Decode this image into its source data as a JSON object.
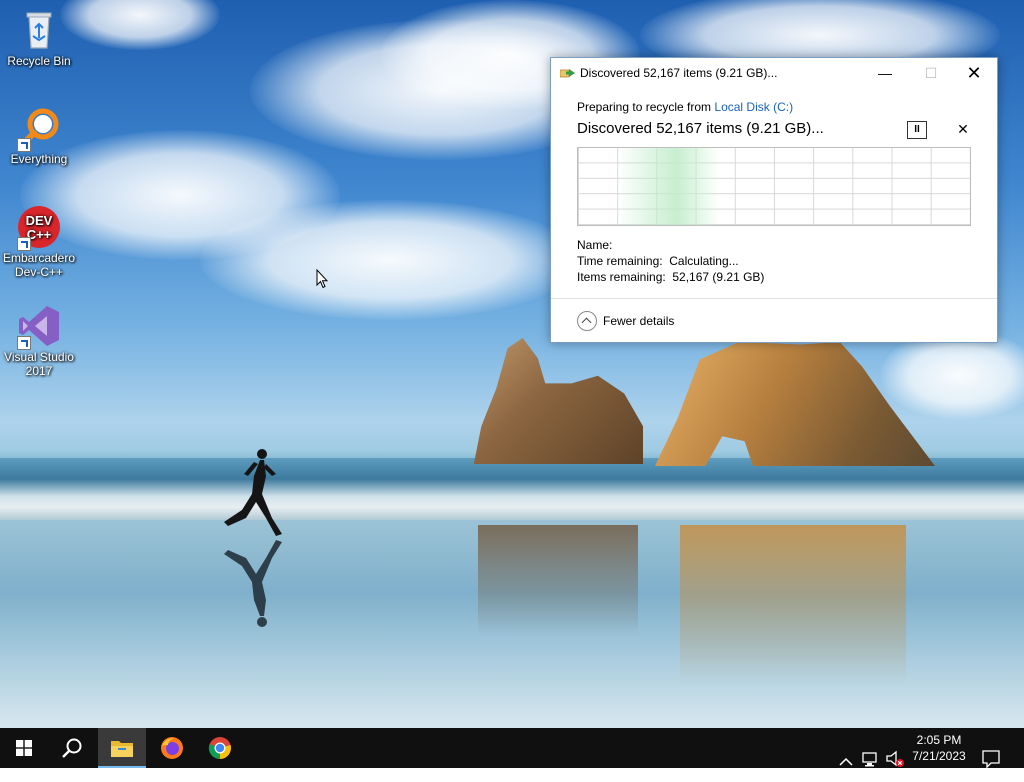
{
  "desktop": {
    "icons": [
      {
        "label": "Recycle Bin"
      },
      {
        "label": "Everything"
      },
      {
        "label": "Embarcadero Dev-C++"
      },
      {
        "label": "Visual Studio 2017"
      }
    ],
    "devcpp_badge": {
      "line1": "DEV",
      "line2": "C++"
    }
  },
  "dialog": {
    "title": "Discovered 52,167 items (9.21 GB)...",
    "preparing_prefix": "Preparing to recycle from",
    "preparing_location": "Local Disk (C:)",
    "status": "Discovered 52,167 items (9.21 GB)...",
    "name_label": "Name:",
    "name_value": "",
    "time_label": "Time remaining:",
    "time_value": "Calculating...",
    "items_label": "Items remaining:",
    "items_value": "52,167 (9.21 GB)",
    "fewer_details": "Fewer details",
    "pause_glyph": "II",
    "cancel_glyph": "✕",
    "minimize_glyph": "—",
    "maximize_glyph": "☐",
    "close_glyph": "✕"
  },
  "taskbar": {
    "pinned": [
      "start-icon",
      "search-icon",
      "file-explorer-icon",
      "firefox-icon",
      "chrome-icon"
    ],
    "tray_icons": [
      "chevron-up-icon",
      "network-icon",
      "volume-muted-icon",
      "notification-icon"
    ],
    "time": "2:05 PM",
    "date": "7/21/2023"
  },
  "colors": {
    "accent": "#1a62b8",
    "taskbar": "#101010",
    "progress_fill": "#bfe6c8"
  }
}
